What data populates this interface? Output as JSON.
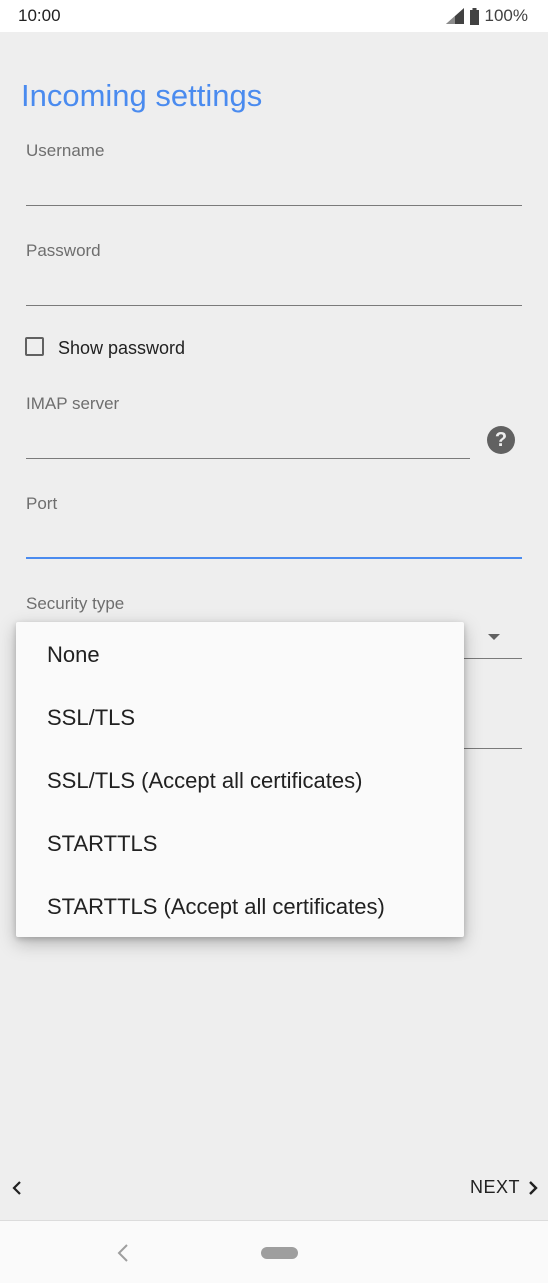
{
  "status_bar": {
    "time": "10:00",
    "battery_percent": "100%",
    "icons": [
      "signal-icon",
      "battery-icon"
    ]
  },
  "screen": {
    "title": "Incoming settings",
    "fields": {
      "username_label": "Username",
      "username_value": "",
      "password_label": "Password",
      "password_value": "",
      "show_password_label": "Show password",
      "show_password_checked": false,
      "imap_label": "IMAP server",
      "imap_value": "",
      "port_label": "Port",
      "port_value": "",
      "security_label": "Security type"
    }
  },
  "security_menu": {
    "options": [
      "None",
      "SSL/TLS",
      "SSL/TLS (Accept all certificates)",
      "STARTTLS",
      "STARTTLS (Accept all certificates)"
    ]
  },
  "footer": {
    "next_label": "NEXT"
  },
  "colors": {
    "accent": "#4a8bef",
    "background": "#eeeeee",
    "menu_background": "#fafafa"
  }
}
